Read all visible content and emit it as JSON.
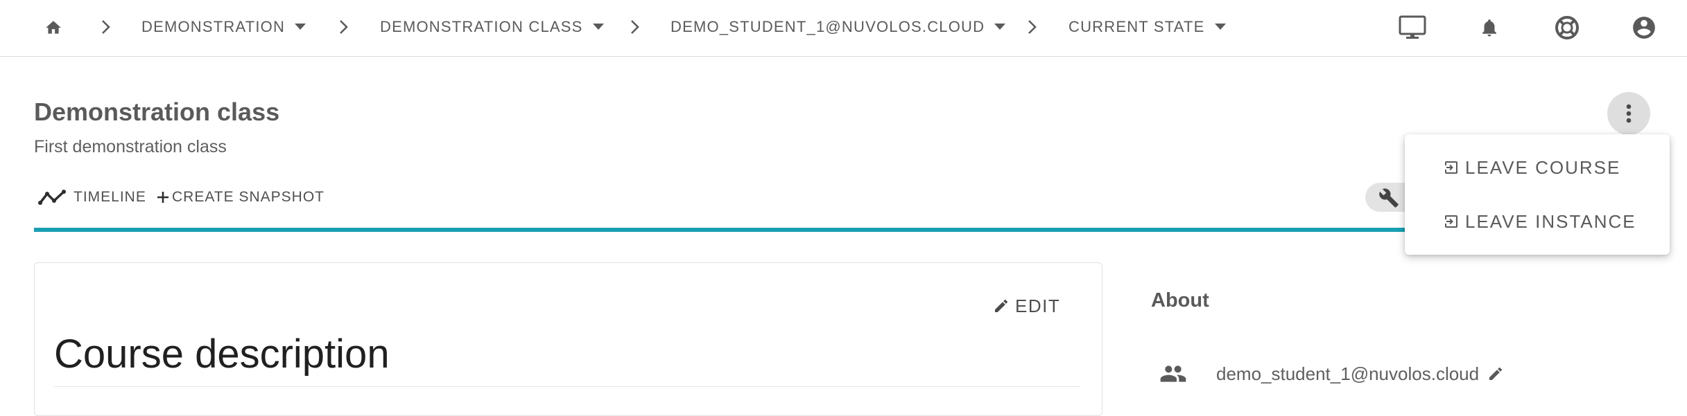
{
  "breadcrumb": {
    "items": [
      {
        "label": "DEMONSTRATION"
      },
      {
        "label": "DEMONSTRATION CLASS"
      },
      {
        "label": "DEMO_STUDENT_1@NUVOLOS.CLOUD"
      },
      {
        "label": "CURRENT STATE"
      }
    ]
  },
  "topbar_icons": [
    "home-icon",
    "monitor-icon",
    "bell-icon",
    "lifebuoy-icon",
    "account-icon"
  ],
  "page": {
    "title": "Demonstration class",
    "subtitle": "First demonstration class"
  },
  "tabs": {
    "timeline_label": "TIMELINE",
    "create_snapshot_label": "CREATE SNAPSHOT"
  },
  "menu": {
    "items": [
      {
        "label": "LEAVE COURSE",
        "icon": "exit-icon"
      },
      {
        "label": "LEAVE INSTANCE",
        "icon": "exit-icon"
      }
    ]
  },
  "card": {
    "edit_label": "EDIT",
    "heading": "Course description"
  },
  "about": {
    "heading": "About",
    "owner": "demo_student_1@nuvolos.cloud"
  },
  "colors": {
    "accent": "#1a9fb2",
    "chip_bg": "#e3e3e3",
    "text": "#5a5a5a"
  }
}
